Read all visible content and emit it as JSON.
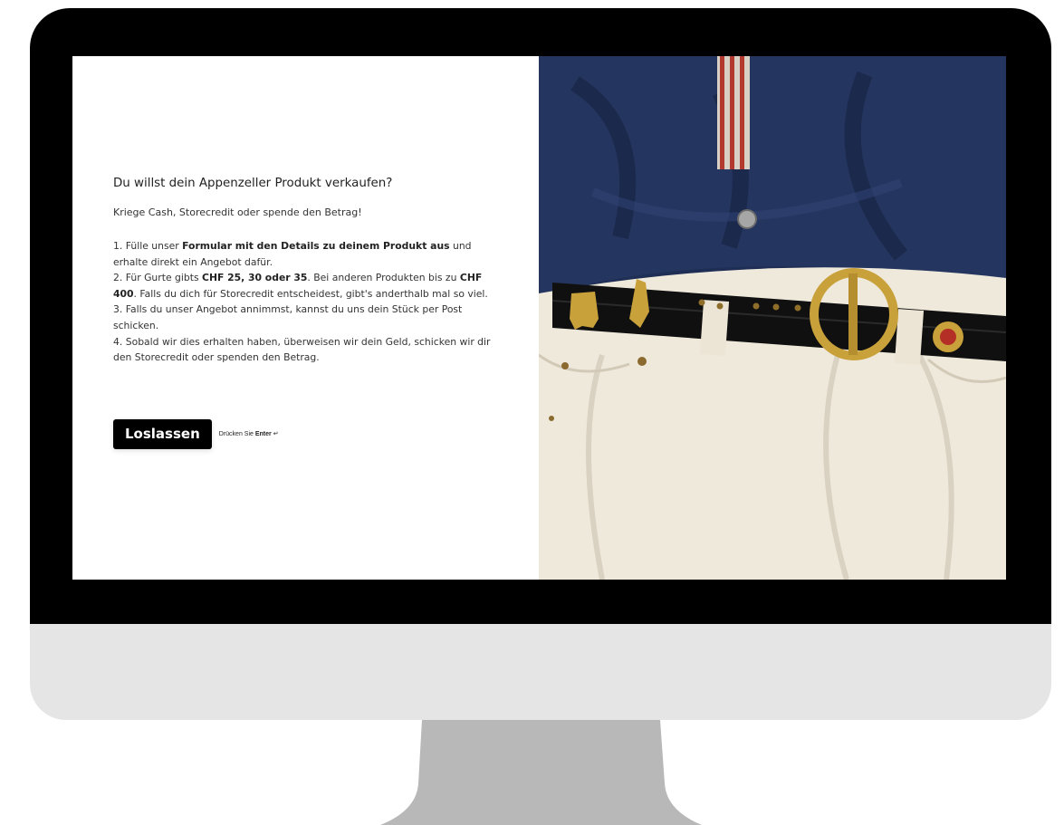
{
  "form": {
    "question": "Du willst dein Appenzeller Produkt verkaufen?",
    "subline": "Kriege Cash, Storecredit oder spende den Betrag!",
    "step1": {
      "a": "1. Fülle unser ",
      "b": "Formular mit den Details zu deinem Produkt aus",
      "c": " und erhalte direkt ein Angebot dafür."
    },
    "step2": {
      "a": "2. Für Gurte gibts ",
      "b": "CHF 25, 30 oder 35",
      "c": ". Bei anderen Produkten bis zu ",
      "d": "CHF 400",
      "e": ". Falls du dich für Storecredit entscheidest, gibt's anderthalb mal so viel."
    },
    "step3": "3. Falls du unser Angebot annimmst, kannst du uns dein Stück per Post schicken.",
    "step4": "4. Sobald wir dies erhalten haben, überweisen wir dein Geld, schicken wir dir den Storecredit oder spenden den Betrag.",
    "submit_label": "Loslassen",
    "hint_prefix": "Drücken Sie ",
    "hint_key": "Enter",
    "hint_icon": "↵"
  },
  "photo": {
    "subject": "appenzeller-belt-photo",
    "colors": {
      "jacket": "#1f2e55",
      "belt": "#111111",
      "buckle": "#c9a13b",
      "jeans": "#efe9dc"
    }
  },
  "device": {
    "bezel_color": "#000000",
    "chin_color": "#e5e5e5",
    "stand_color": "#b8b8b8"
  }
}
